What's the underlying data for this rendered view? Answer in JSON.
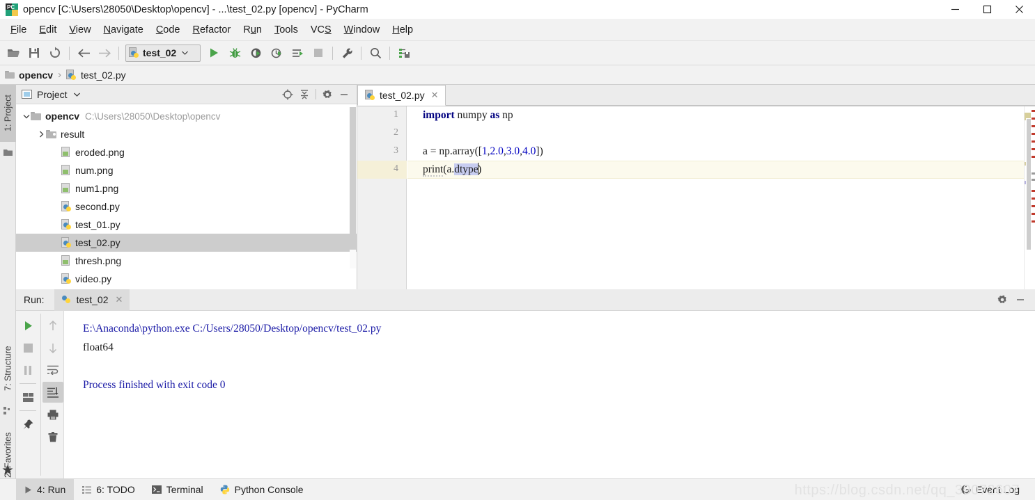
{
  "window": {
    "title": "opencv [C:\\Users\\28050\\Desktop\\opencv] - ...\\test_02.py [opencv] - PyCharm",
    "app_icon": "pycharm-logo-icon",
    "minimize_label": "—",
    "maximize_label": "□",
    "close_label": "✕"
  },
  "menubar": {
    "items": [
      {
        "label": "File",
        "mnemonic": "F"
      },
      {
        "label": "Edit",
        "mnemonic": "E"
      },
      {
        "label": "View",
        "mnemonic": "V"
      },
      {
        "label": "Navigate",
        "mnemonic": "N"
      },
      {
        "label": "Code",
        "mnemonic": "C"
      },
      {
        "label": "Refactor",
        "mnemonic": "R"
      },
      {
        "label": "Run",
        "mnemonic": "u"
      },
      {
        "label": "Tools",
        "mnemonic": "T"
      },
      {
        "label": "VCS",
        "mnemonic": "S"
      },
      {
        "label": "Window",
        "mnemonic": "W"
      },
      {
        "label": "Help",
        "mnemonic": "H"
      }
    ]
  },
  "toolbar": {
    "open_icon": "open-folder-icon",
    "save_icon": "save-disk-icon",
    "sync_icon": "refresh-sync-icon",
    "back_icon": "arrow-left-icon",
    "forward_icon": "arrow-right-icon",
    "run_config": {
      "label": "test_02",
      "icon": "python-file-icon",
      "chevron": "chevron-down-icon"
    },
    "run_icon": "run-play-icon",
    "debug_icon": "debug-bug-icon",
    "coverage_icon": "run-coverage-icon",
    "profile_icon": "run-profile-icon",
    "run_console_icon": "run-with-console-icon",
    "stop_icon": "stop-square-icon",
    "settings_icon": "wrench-settings-icon",
    "search_icon": "search-magnifier-icon",
    "updates_icon": "update-project-icon"
  },
  "breadcrumb": {
    "items": [
      {
        "label": "opencv",
        "icon": "folder-icon",
        "bold": true
      },
      {
        "label": "test_02.py",
        "icon": "python-file-icon",
        "bold": false
      }
    ],
    "separator": "›"
  },
  "left_strip": {
    "tabs": [
      {
        "label": "1: Project",
        "mnemonic": "1",
        "icon": "project-folder-icon",
        "active": true
      },
      {
        "label": "7: Structure",
        "mnemonic": "7",
        "icon": "structure-icon",
        "active": false
      },
      {
        "label": "2: Favorites",
        "mnemonic": "2",
        "icon": "star-icon",
        "active": false
      }
    ]
  },
  "project_panel": {
    "title": "Project",
    "window_icon": "project-window-icon",
    "chevron": "chevron-down-icon",
    "actions": [
      {
        "name": "locate-target-icon",
        "label": "Select Opened File"
      },
      {
        "name": "collapse-all-icon",
        "label": "Collapse All"
      },
      {
        "name": "gear-icon",
        "label": "Settings"
      },
      {
        "name": "minimize-icon",
        "label": "Hide"
      }
    ],
    "tree": [
      {
        "name": "opencv",
        "path": "C:\\Users\\28050\\Desktop\\opencv",
        "type": "folder",
        "icon": "folder-icon",
        "indent": 0,
        "arrow": "expanded",
        "bold": true,
        "selected": false
      },
      {
        "name": "result",
        "path": "",
        "type": "folder",
        "icon": "folder-icon",
        "indent": 1,
        "arrow": "collapsed",
        "bold": false,
        "selected": false
      },
      {
        "name": "eroded.png",
        "path": "",
        "type": "image",
        "icon": "image-file-icon",
        "indent": 2,
        "arrow": "none",
        "bold": false,
        "selected": false
      },
      {
        "name": "num.png",
        "path": "",
        "type": "image",
        "icon": "image-file-icon",
        "indent": 2,
        "arrow": "none",
        "bold": false,
        "selected": false
      },
      {
        "name": "num1.png",
        "path": "",
        "type": "image",
        "icon": "image-file-icon",
        "indent": 2,
        "arrow": "none",
        "bold": false,
        "selected": false
      },
      {
        "name": "second.py",
        "path": "",
        "type": "python",
        "icon": "python-file-icon",
        "indent": 2,
        "arrow": "none",
        "bold": false,
        "selected": false
      },
      {
        "name": "test_01.py",
        "path": "",
        "type": "python",
        "icon": "python-file-icon",
        "indent": 2,
        "arrow": "none",
        "bold": false,
        "selected": false
      },
      {
        "name": "test_02.py",
        "path": "",
        "type": "python",
        "icon": "python-file-icon",
        "indent": 2,
        "arrow": "none",
        "bold": false,
        "selected": true
      },
      {
        "name": "thresh.png",
        "path": "",
        "type": "image",
        "icon": "image-file-icon",
        "indent": 2,
        "arrow": "none",
        "bold": false,
        "selected": false
      },
      {
        "name": "video.py",
        "path": "",
        "type": "python",
        "icon": "python-file-icon",
        "indent": 2,
        "arrow": "none",
        "bold": false,
        "selected": false
      }
    ]
  },
  "editor": {
    "tab": {
      "label": "test_02.py",
      "icon": "python-file-icon",
      "close": "✕"
    },
    "line_numbers": [
      "1",
      "2",
      "3",
      "4"
    ],
    "highlighted_line": 4,
    "code_lines": [
      {
        "n": 1,
        "text": "import numpy as np"
      },
      {
        "n": 2,
        "text": ""
      },
      {
        "n": 3,
        "text": "a = np.array([1,2.0,3.0,4.0])"
      },
      {
        "n": 4,
        "text": "print(a.dtype)"
      }
    ],
    "selection_text": "dtype",
    "caret_line": 4
  },
  "run_panel": {
    "label": "Run:",
    "tab": {
      "label": "test_02",
      "icon": "python-icon",
      "close": "✕"
    },
    "actions": [
      {
        "name": "rerun-play-icon"
      },
      {
        "name": "stop-square-icon"
      },
      {
        "name": "pause-icon"
      },
      {
        "name": "layout-icon"
      },
      {
        "name": "pin-icon"
      },
      {
        "name": "up-arrow-icon"
      },
      {
        "name": "down-arrow-icon"
      },
      {
        "name": "soft-wrap-icon"
      },
      {
        "name": "scroll-to-end-icon"
      },
      {
        "name": "print-icon"
      },
      {
        "name": "trash-icon"
      }
    ],
    "right_actions": [
      {
        "name": "gear-icon"
      },
      {
        "name": "minimize-icon"
      }
    ],
    "console": [
      {
        "text": "E:\\Anaconda\\python.exe C:/Users/28050/Desktop/opencv/test_02.py",
        "color": "blue"
      },
      {
        "text": "float64",
        "color": "black"
      },
      {
        "text": "",
        "color": "black"
      },
      {
        "text": "Process finished with exit code 0",
        "color": "blue"
      }
    ]
  },
  "statusbar": {
    "items": [
      {
        "label": "4: Run",
        "mnemonic": "4",
        "icon": "run-play-icon",
        "active": true
      },
      {
        "label": "6: TODO",
        "mnemonic": "6",
        "icon": "todo-list-icon",
        "active": false
      },
      {
        "label": "Terminal",
        "mnemonic": "",
        "icon": "terminal-icon",
        "active": false
      },
      {
        "label": "Python Console",
        "mnemonic": "",
        "icon": "python-icon",
        "active": false
      }
    ],
    "event_log": {
      "label": "Event Log",
      "icon": "event-log-icon"
    },
    "watermark": "https://blog.csdn.net/qq_39072607"
  },
  "colors": {
    "accent_green": "#4aa44a",
    "keyword_blue": "#000080",
    "number_blue": "#0000c0",
    "console_blue": "#1a1aa6",
    "selection": "#c8cdf0",
    "highlight_line": "#fcfaed",
    "selected_row": "#cdcdcd"
  }
}
